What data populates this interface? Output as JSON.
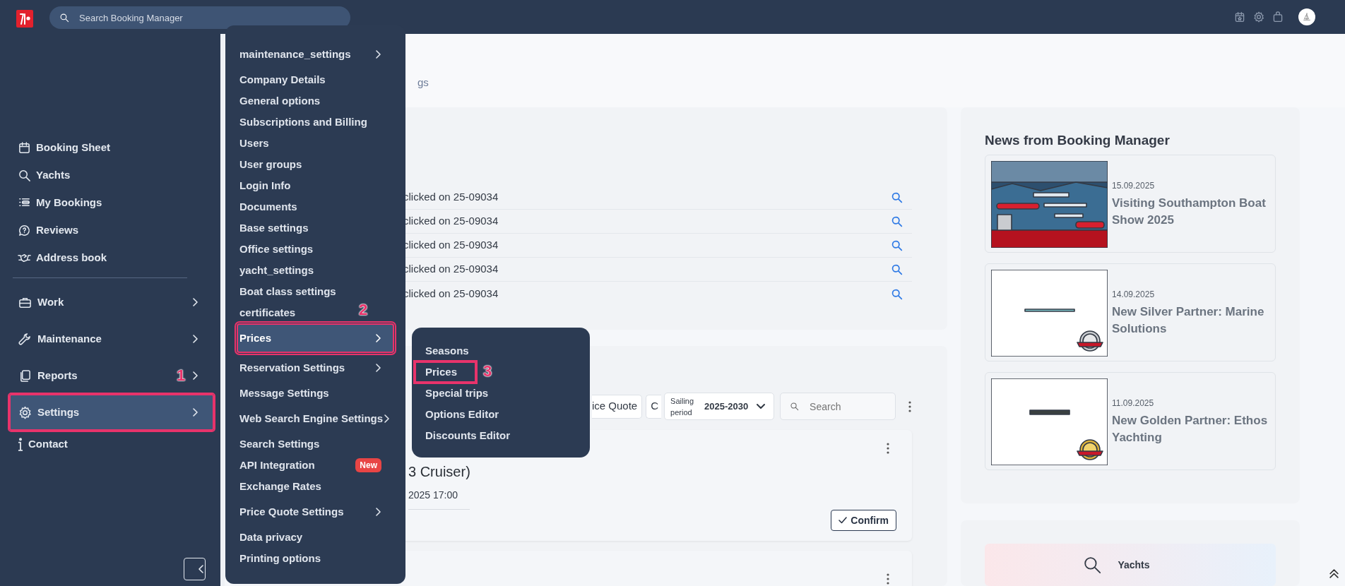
{
  "topbar": {
    "search": {
      "placeholder": "Search Booking Manager"
    }
  },
  "sidebar": {
    "items": [
      {
        "label": "Booking Sheet"
      },
      {
        "label": "Yachts"
      },
      {
        "label": "My Bookings"
      },
      {
        "label": "Reviews"
      },
      {
        "label": "Address book"
      }
    ],
    "menu_items": [
      {
        "label": "Work",
        "kind": "group",
        "has_submenu": true,
        "selected": false,
        "outlined": false
      },
      {
        "label": "Maintenance",
        "kind": "group",
        "has_submenu": true,
        "selected": false,
        "outlined": false
      },
      {
        "label": "Reports",
        "kind": "group",
        "has_submenu": true,
        "selected": false,
        "outlined": false
      },
      {
        "label": "Settings",
        "kind": "group",
        "has_submenu": true,
        "selected": true,
        "outlined": true
      },
      {
        "label": "Contact",
        "kind": "link",
        "has_submenu": false,
        "selected": false,
        "outlined": false
      }
    ]
  },
  "settings_menu": {
    "items": [
      {
        "label": "maintenance_settings",
        "has_submenu": true,
        "selected": false,
        "outlined": false
      },
      {
        "label": "Company Details",
        "has_submenu": false,
        "selected": false,
        "outlined": false
      },
      {
        "label": "General options",
        "has_submenu": false,
        "selected": false,
        "outlined": false
      },
      {
        "label": "Subscriptions and Billing",
        "has_submenu": false,
        "selected": false,
        "outlined": false
      },
      {
        "label": "Users",
        "has_submenu": false,
        "selected": false,
        "outlined": false
      },
      {
        "label": "User groups",
        "has_submenu": false,
        "selected": false,
        "outlined": false
      },
      {
        "label": "Login Info",
        "has_submenu": false,
        "selected": false,
        "outlined": false
      },
      {
        "label": "Documents",
        "has_submenu": false,
        "selected": false,
        "outlined": false
      },
      {
        "label": "Base settings",
        "has_submenu": false,
        "selected": false,
        "outlined": false
      },
      {
        "label": "Office settings",
        "has_submenu": false,
        "selected": false,
        "outlined": false
      },
      {
        "label": "yacht_settings",
        "has_submenu": false,
        "selected": false,
        "outlined": false
      },
      {
        "label": "Boat class settings",
        "has_submenu": false,
        "selected": false,
        "outlined": false
      },
      {
        "label": "certificates",
        "has_submenu": false,
        "selected": false,
        "outlined": false
      },
      {
        "label": "Prices",
        "has_submenu": true,
        "selected": true,
        "outlined": true
      },
      {
        "label": "Reservation Settings",
        "has_submenu": true,
        "selected": false,
        "outlined": false
      },
      {
        "label": "Message Settings",
        "has_submenu": false,
        "selected": false,
        "outlined": false
      },
      {
        "label": "Web Search Engine Settings",
        "has_submenu": true,
        "selected": false,
        "outlined": false
      },
      {
        "label": "Search Settings",
        "has_submenu": false,
        "selected": false,
        "outlined": false
      },
      {
        "label": "API Integration",
        "has_submenu": false,
        "selected": false,
        "outlined": false,
        "badge": "New"
      },
      {
        "label": "Exchange Rates",
        "has_submenu": false,
        "selected": false,
        "outlined": false
      },
      {
        "label": "Price Quote Settings",
        "has_submenu": true,
        "selected": false,
        "outlined": false
      },
      {
        "label": "Data privacy",
        "has_submenu": false,
        "selected": false,
        "outlined": false
      },
      {
        "label": "Printing options",
        "has_submenu": false,
        "selected": false,
        "outlined": false
      }
    ]
  },
  "prices_submenu": {
    "items": [
      {
        "label": "Seasons",
        "outlined": false
      },
      {
        "label": "Prices",
        "outlined": true
      },
      {
        "label": "Special trips",
        "outlined": false
      },
      {
        "label": "Options Editor",
        "outlined": false
      },
      {
        "label": "Discounts Editor",
        "outlined": false
      }
    ]
  },
  "callouts": [
    {
      "label": "1"
    },
    {
      "label": "2"
    },
    {
      "label": "3"
    }
  ],
  "main": {
    "breadcrumb": "gs",
    "activity": {
      "rows": [
        {
          "text": "clicked on 25-09034"
        },
        {
          "text": "clicked on 25-09034"
        },
        {
          "text": "clicked on 25-09034"
        },
        {
          "text": "clicked on 25-09034"
        },
        {
          "text": "clicked on 25-09034"
        }
      ]
    },
    "bookings": {
      "toolbar_buttons": [
        "ice Quote",
        "C"
      ],
      "sailing_period": {
        "label": "Sailing period",
        "value": "2025-2030"
      },
      "search": {
        "placeholder": "Search"
      },
      "card": {
        "title": "3 Cruiser)",
        "time": "2025 17:00",
        "action": "Confirm"
      }
    }
  },
  "news": {
    "title": "News from Booking Manager",
    "items": [
      {
        "date": "15.09.2025",
        "title": "Visiting Southampton Boat Show 2025",
        "kind": "picture"
      },
      {
        "date": "14.09.2025",
        "title": "New Silver Partner: Marine Solutions",
        "kind": "picture"
      },
      {
        "date": "11.09.2025",
        "title": "New Golden Partner: Ethos Yachting",
        "kind": "picture"
      }
    ]
  },
  "quick_search": {
    "label": "Yachts"
  }
}
